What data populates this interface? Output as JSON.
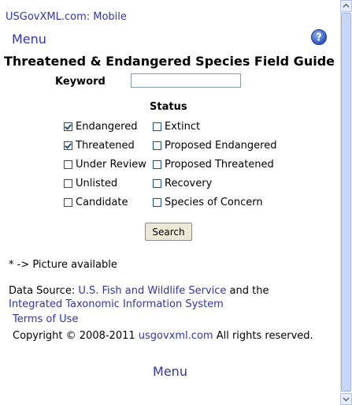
{
  "header": {
    "site_title": "USGovXML.com: Mobile",
    "menu_label": "Menu",
    "help_icon": "help-icon"
  },
  "page_title": "Threatened & Endangered Species Field Guide",
  "search": {
    "keyword_label": "Keyword",
    "keyword_value": "",
    "status_heading": "Status",
    "button_label": "Search"
  },
  "status_options": [
    {
      "label": "Endangered",
      "checked": true
    },
    {
      "label": "Threatened",
      "checked": true
    },
    {
      "label": "Under Review",
      "checked": false
    },
    {
      "label": "Unlisted",
      "checked": false
    },
    {
      "label": "Candidate",
      "checked": false
    },
    {
      "label": "Extinct",
      "checked": false
    },
    {
      "label": "Proposed Endangered",
      "checked": false
    },
    {
      "label": "Proposed Threatened",
      "checked": false
    },
    {
      "label": "Recovery",
      "checked": false
    },
    {
      "label": "Species of Concern",
      "checked": false
    }
  ],
  "footer": {
    "picture_note": "* -> Picture available",
    "data_source_prefix": "Data Source: ",
    "data_source_link1": "U.S. Fish and Wildlife Service",
    "data_source_middle": " and the",
    "data_source_link2": "Integrated Taxonomic Information System",
    "terms_label": "Terms of Use",
    "copyright_prefix": "Copyright © 2008-2011 ",
    "copyright_link": "usgovxml.com",
    "copyright_suffix": " All rights reserved.",
    "menu_label": "Menu"
  },
  "colors": {
    "link": "#3333aa",
    "checkbox_border": "#1c5180",
    "button_bg": "#ece9d8"
  }
}
